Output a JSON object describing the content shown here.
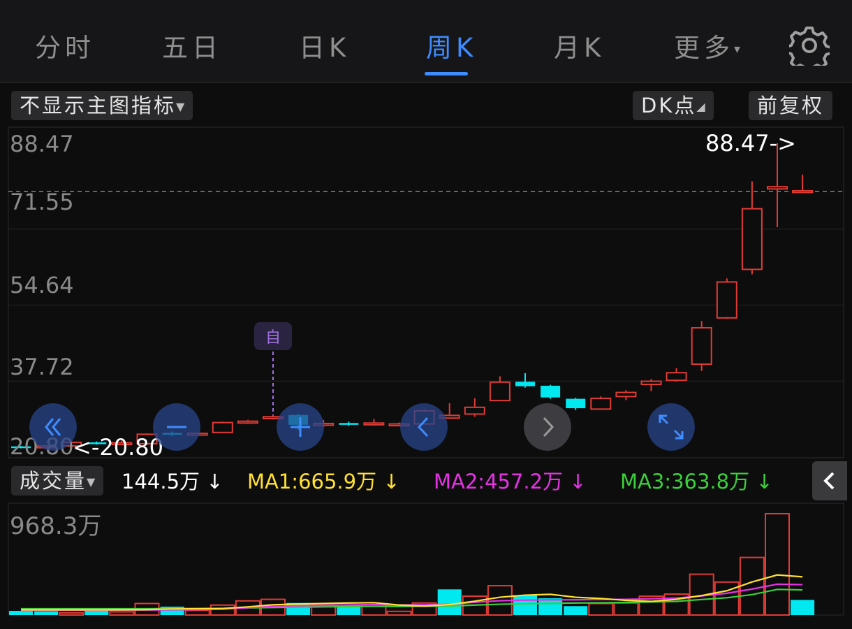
{
  "tabs": [
    {
      "label": "分时",
      "active": false
    },
    {
      "label": "五日",
      "active": false
    },
    {
      "label": "日K",
      "active": false
    },
    {
      "label": "周K",
      "active": true
    },
    {
      "label": "月K",
      "active": false
    },
    {
      "label": "更多",
      "active": false
    }
  ],
  "icons": {
    "more_arrow": "▾",
    "settings": "gear-icon"
  },
  "toolbar": {
    "indicator_select": "不显示主图指标",
    "dk_label": "DK点",
    "adjust_label": "前复权"
  },
  "price_axis": [
    "88.47",
    "71.55",
    "54.64",
    "37.72",
    "20.80"
  ],
  "high_marker": "88.47->",
  "low_marker": "<-20.80",
  "annotation": "自",
  "volume_header": {
    "select": "成交量",
    "vol": "144.5万",
    "ma1": "MA1:665.9万",
    "ma2": "MA2:457.2万",
    "ma3": "MA3:363.8万",
    "arrow": "↓"
  },
  "volume_axis_max": "968.3万",
  "colors": {
    "up": "#e03b35",
    "down": "#00e8f0",
    "accent": "#3f8cff",
    "ma1": "#ffe033",
    "ma2": "#e633e6",
    "ma3": "#3ccf3c",
    "annotation": "#a070e0"
  },
  "controls": [
    "double-left-icon",
    "minus-icon",
    "plus-icon",
    "chevron-left-icon",
    "chevron-right-icon",
    "expand-icon"
  ],
  "chart_data": {
    "type": "candlestick",
    "ylim": [
      20.8,
      88.47
    ],
    "candles": [
      {
        "o": 20.8,
        "c": 21.0,
        "h": 21.1,
        "l": 20.6,
        "dir": "down"
      },
      {
        "o": 20.9,
        "c": 21.1,
        "h": 21.2,
        "l": 20.7,
        "dir": "up"
      },
      {
        "o": 21.1,
        "c": 21.9,
        "h": 22.0,
        "l": 21.0,
        "dir": "up"
      },
      {
        "o": 21.9,
        "c": 21.5,
        "h": 22.1,
        "l": 21.4,
        "dir": "down"
      },
      {
        "o": 21.5,
        "c": 21.8,
        "h": 22.3,
        "l": 21.4,
        "dir": "up"
      },
      {
        "o": 21.6,
        "c": 23.7,
        "h": 23.9,
        "l": 21.6,
        "dir": "up"
      },
      {
        "o": 23.6,
        "c": 24.0,
        "h": 24.3,
        "l": 23.3,
        "dir": "down"
      },
      {
        "o": 23.7,
        "c": 23.9,
        "h": 24.1,
        "l": 23.5,
        "dir": "up"
      },
      {
        "o": 24.1,
        "c": 26.3,
        "h": 26.5,
        "l": 24.1,
        "dir": "up"
      },
      {
        "o": 26.2,
        "c": 26.6,
        "h": 26.9,
        "l": 26.0,
        "dir": "up"
      },
      {
        "o": 27.2,
        "c": 27.6,
        "h": 27.9,
        "l": 27.0,
        "dir": "up"
      },
      {
        "o": 28.0,
        "c": 25.8,
        "h": 28.2,
        "l": 24.7,
        "dir": "down"
      },
      {
        "o": 25.8,
        "c": 26.1,
        "h": 26.9,
        "l": 25.3,
        "dir": "up"
      },
      {
        "o": 25.8,
        "c": 26.2,
        "h": 26.5,
        "l": 25.6,
        "dir": "down"
      },
      {
        "o": 25.9,
        "c": 26.2,
        "h": 27.1,
        "l": 25.6,
        "dir": "up"
      },
      {
        "o": 25.9,
        "c": 26.0,
        "h": 26.3,
        "l": 25.8,
        "dir": "up"
      },
      {
        "o": 26.0,
        "c": 28.9,
        "h": 29.3,
        "l": 26.0,
        "dir": "up"
      },
      {
        "o": 27.3,
        "c": 27.9,
        "h": 30.6,
        "l": 27.1,
        "dir": "up"
      },
      {
        "o": 28.2,
        "c": 29.7,
        "h": 31.7,
        "l": 27.6,
        "dir": "up"
      },
      {
        "o": 31.2,
        "c": 35.3,
        "h": 36.6,
        "l": 31.2,
        "dir": "up"
      },
      {
        "o": 35.4,
        "c": 34.4,
        "h": 37.3,
        "l": 34.1,
        "dir": "down"
      },
      {
        "o": 34.5,
        "c": 31.9,
        "h": 34.7,
        "l": 31.6,
        "dir": "down"
      },
      {
        "o": 31.6,
        "c": 29.5,
        "h": 31.8,
        "l": 29.1,
        "dir": "down"
      },
      {
        "o": 29.3,
        "c": 31.7,
        "h": 32.1,
        "l": 29.3,
        "dir": "up"
      },
      {
        "o": 32.1,
        "c": 33.0,
        "h": 33.5,
        "l": 31.3,
        "dir": "up"
      },
      {
        "o": 34.8,
        "c": 35.5,
        "h": 36.0,
        "l": 33.3,
        "dir": "up"
      },
      {
        "o": 35.7,
        "c": 37.4,
        "h": 38.4,
        "l": 35.4,
        "dir": "up"
      },
      {
        "o": 39.3,
        "c": 47.4,
        "h": 48.9,
        "l": 37.8,
        "dir": "up"
      },
      {
        "o": 49.6,
        "c": 57.6,
        "h": 58.4,
        "l": 49.4,
        "dir": "up"
      },
      {
        "o": 60.4,
        "c": 73.9,
        "h": 80.0,
        "l": 59.3,
        "dir": "up"
      },
      {
        "o": 78.3,
        "c": 78.8,
        "h": 88.47,
        "l": 69.8,
        "dir": "up"
      },
      {
        "o": 77.9,
        "c": 77.6,
        "h": 81.5,
        "l": 77.4,
        "dir": "up"
      }
    ],
    "volume_max": 968.3,
    "volume": [
      {
        "v": 40,
        "dir": "down"
      },
      {
        "v": 35,
        "dir": "down"
      },
      {
        "v": 20,
        "dir": "up"
      },
      {
        "v": 45,
        "dir": "down"
      },
      {
        "v": 30,
        "dir": "up"
      },
      {
        "v": 110,
        "dir": "up"
      },
      {
        "v": 80,
        "dir": "down"
      },
      {
        "v": 45,
        "dir": "up"
      },
      {
        "v": 95,
        "dir": "up"
      },
      {
        "v": 135,
        "dir": "up"
      },
      {
        "v": 150,
        "dir": "up"
      },
      {
        "v": 115,
        "dir": "down"
      },
      {
        "v": 95,
        "dir": "up"
      },
      {
        "v": 90,
        "dir": "down"
      },
      {
        "v": 100,
        "dir": "up"
      },
      {
        "v": 35,
        "dir": "up"
      },
      {
        "v": 115,
        "dir": "up"
      },
      {
        "v": 245,
        "dir": "down"
      },
      {
        "v": 180,
        "dir": "up"
      },
      {
        "v": 280,
        "dir": "up"
      },
      {
        "v": 190,
        "dir": "down"
      },
      {
        "v": 160,
        "dir": "down"
      },
      {
        "v": 85,
        "dir": "down"
      },
      {
        "v": 110,
        "dir": "up"
      },
      {
        "v": 115,
        "dir": "up"
      },
      {
        "v": 180,
        "dir": "up"
      },
      {
        "v": 200,
        "dir": "up"
      },
      {
        "v": 390,
        "dir": "up"
      },
      {
        "v": 315,
        "dir": "up"
      },
      {
        "v": 550,
        "dir": "up"
      },
      {
        "v": 968.3,
        "dir": "up"
      },
      {
        "v": 144.5,
        "dir": "down"
      }
    ],
    "ma1": [
      50,
      50,
      50,
      50,
      50,
      52,
      58,
      60,
      62,
      78,
      98,
      105,
      110,
      115,
      118,
      95,
      85,
      100,
      132,
      170,
      190,
      198,
      170,
      158,
      140,
      130,
      150,
      186,
      232,
      316,
      383,
      365
    ],
    "ma2": [
      45,
      45,
      46,
      46,
      47,
      48,
      50,
      52,
      56,
      70,
      82,
      88,
      92,
      96,
      100,
      96,
      98,
      102,
      122,
      137,
      142,
      145,
      145,
      148,
      150,
      155,
      162,
      182,
      208,
      248,
      295,
      290
    ],
    "ma3": [
      60,
      60,
      60,
      60,
      60,
      60,
      62,
      62,
      64,
      68,
      72,
      75,
      78,
      80,
      83,
      82,
      84,
      86,
      95,
      103,
      108,
      112,
      115,
      117,
      120,
      125,
      130,
      148,
      165,
      195,
      245,
      240
    ]
  }
}
